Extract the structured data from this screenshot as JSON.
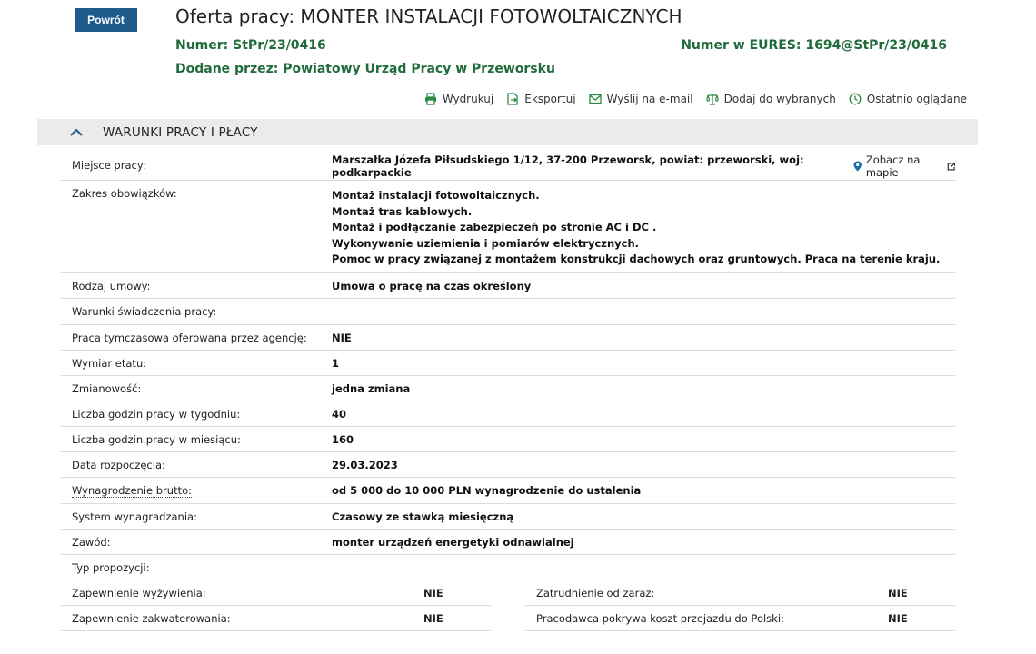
{
  "header": {
    "back_label": "Powrót",
    "title": "Oferta pracy: MONTER INSTALACJI FOTOWOLTAICZNYCH",
    "number_label": "Numer:",
    "number_value": "StPr/23/0416",
    "eures_label": "Numer w EURES:",
    "eures_value": "1694@StPr/23/0416",
    "added_by_label": "Dodane przez:",
    "added_by_value": "Powiatowy Urząd Pracy w Przeworsku"
  },
  "toolbar": {
    "print": "Wydrukuj",
    "export": "Eksportuj",
    "email": "Wyślij na e-mail",
    "add_fav": "Dodaj do wybranych",
    "recent": "Ostatnio oglądane"
  },
  "section": {
    "title": "WARUNKI PRACY I PŁACY"
  },
  "rows": {
    "location": {
      "label": "Miejsce pracy:",
      "value": "Marszałka Józefa Piłsudskiego 1/12, 37-200 Przeworsk, powiat: przeworski, woj: podkarpackie",
      "map_link": "Zobacz na mapie"
    },
    "duties": {
      "label": "Zakres obowiązków:",
      "lines": [
        "Montaż instalacji fotowoltaicznych.",
        "Montaż tras kablowych.",
        "Montaż i podłączanie zabezpieczeń po stronie AC i DC .",
        "Wykonywanie uziemienia i pomiarów elektrycznych.",
        "Pomoc w pracy związanej z montażem konstrukcji dachowych oraz gruntowych. Praca na terenie kraju."
      ]
    },
    "contract": {
      "label": "Rodzaj umowy:",
      "value": "Umowa o pracę na czas określony"
    },
    "conditions": {
      "label": "Warunki świadczenia pracy:",
      "value": ""
    },
    "temp_agency": {
      "label": "Praca tymczasowa oferowana przez agencję:",
      "value": "NIE"
    },
    "fte": {
      "label": "Wymiar etatu:",
      "value": "1"
    },
    "shifts": {
      "label": "Zmianowość:",
      "value": "jedna zmiana"
    },
    "hours_week": {
      "label": "Liczba godzin pracy w tygodniu:",
      "value": "40"
    },
    "hours_month": {
      "label": "Liczba godzin pracy w miesiącu:",
      "value": "160"
    },
    "start_date": {
      "label": "Data rozpoczęcia:",
      "value": "29.03.2023"
    },
    "salary": {
      "label": "Wynagrodzenie brutto:",
      "value": "od 5 000 do 10 000 PLN wynagrodzenie do ustalenia"
    },
    "pay_system": {
      "label": "System wynagradzania:",
      "value": "Czasowy ze stawką miesięczną"
    },
    "profession": {
      "label": "Zawód:",
      "value": "monter urządzeń energetyki odnawialnej"
    },
    "proposal_type": {
      "label": "Typ propozycji:",
      "value": ""
    }
  },
  "split": {
    "meals": {
      "label": "Zapewnienie wyżywienia:",
      "value": "NIE"
    },
    "immediate": {
      "label": "Zatrudnienie od zaraz:",
      "value": "NIE"
    },
    "housing": {
      "label": "Zapewnienie zakwaterowania:",
      "value": "NIE"
    },
    "travel": {
      "label": "Pracodawca pokrywa koszt przejazdu do Polski:",
      "value": "NIE"
    }
  },
  "colors": {
    "brand_blue": "#1e5b8c",
    "green": "#1f6b3a",
    "header_bg": "#ebebeb"
  }
}
